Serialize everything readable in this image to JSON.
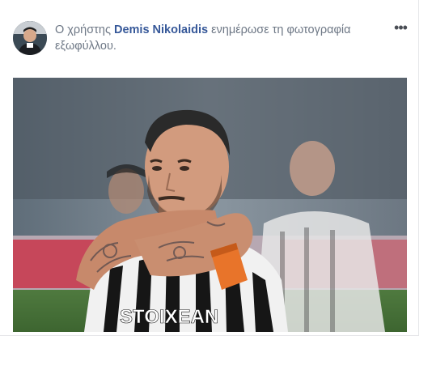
{
  "post": {
    "prefix": "Ο χρήστης",
    "author": "Demis Nikolaidis",
    "action": "ενημέρωσε τη φωτογραφία εξωφύλλου.",
    "more_icon": "ellipsis-icon",
    "avatar_icon": "profile-avatar",
    "photo_subject": "cover-photo",
    "photo_shirt_text": "STOIXEAN"
  },
  "colors": {
    "author_link": "#365899",
    "secondary_text": "#6d7785",
    "card_border": "#e5e6e9"
  }
}
